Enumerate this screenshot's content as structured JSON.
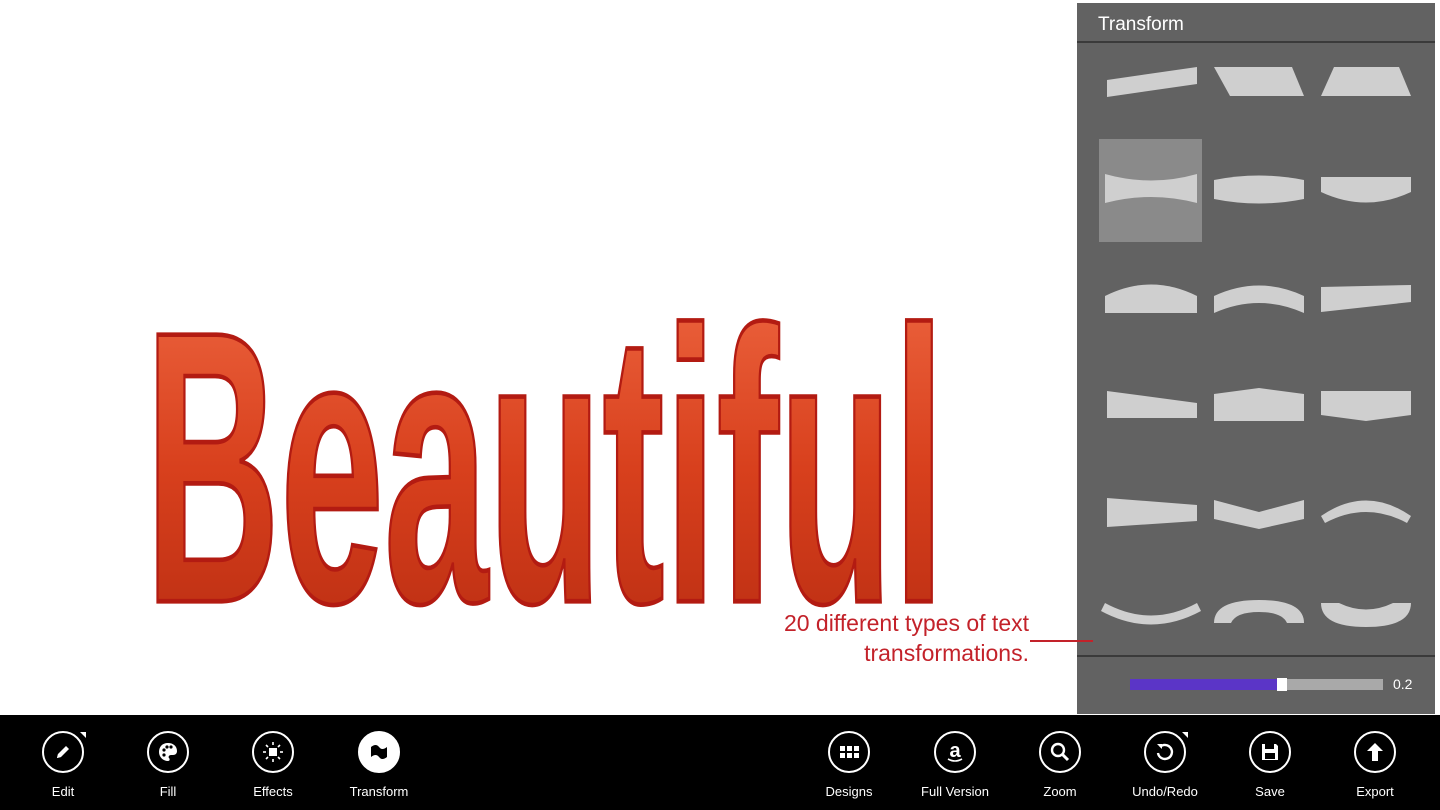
{
  "canvas": {
    "word": "Beautiful",
    "text_color": "#d8401d",
    "outline_color": "#b31b12"
  },
  "panel": {
    "title": "Transform",
    "options_count": 18,
    "selected_index": 3,
    "slider_value_label": "0.2",
    "slider_fill_fraction": 0.6
  },
  "callout": {
    "line1": "20 different types of text",
    "line2": "transformations."
  },
  "appbar": {
    "left": [
      {
        "label": "Edit",
        "icon": "pencil-icon"
      },
      {
        "label": "Fill",
        "icon": "palette-icon"
      },
      {
        "label": "Effects",
        "icon": "sparkle-icon"
      },
      {
        "label": "Transform",
        "icon": "flag-icon"
      }
    ],
    "right": [
      {
        "label": "Designs",
        "icon": "grid-icon"
      },
      {
        "label": "Full Version",
        "icon": "amazon-icon"
      },
      {
        "label": "Zoom",
        "icon": "magnifier-icon"
      },
      {
        "label": "Undo/Redo",
        "icon": "undo-icon"
      },
      {
        "label": "Save",
        "icon": "floppy-icon"
      },
      {
        "label": "Export",
        "icon": "upload-arrow-icon"
      }
    ]
  },
  "colors": {
    "accent_slider": "#5b35c7",
    "panel_bg": "#626262",
    "callout": "#c3222a",
    "appbar_bg": "#000000"
  }
}
